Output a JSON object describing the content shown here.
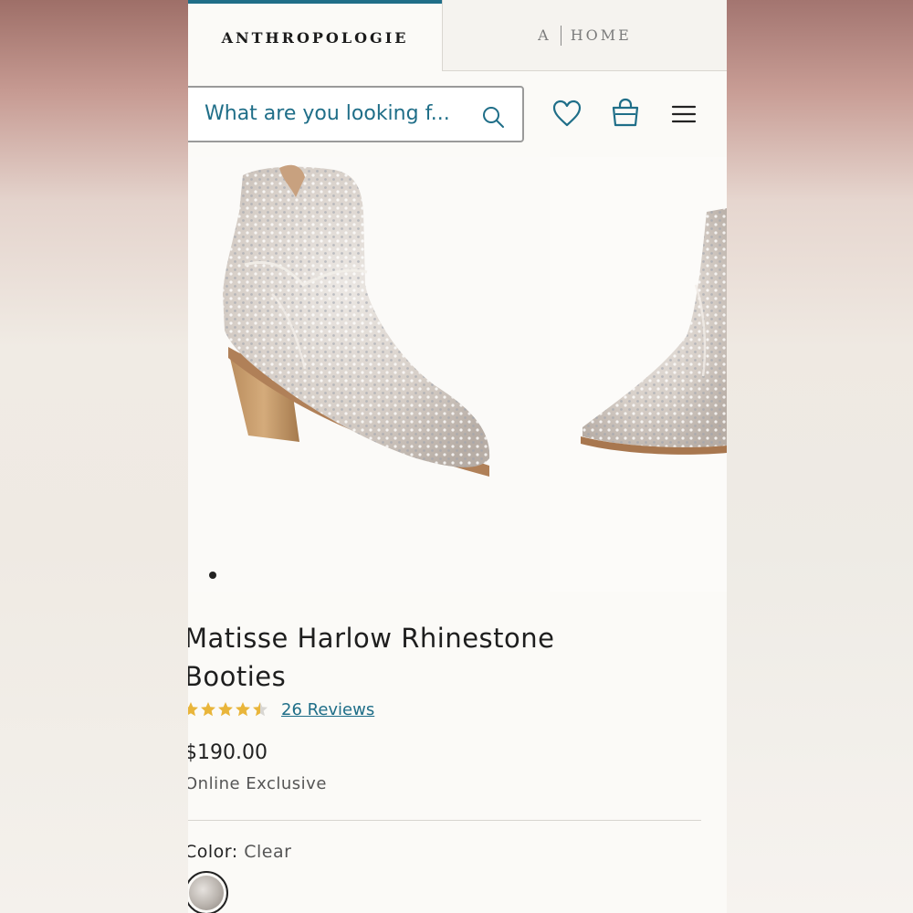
{
  "brands": {
    "primary_tab": "ANTHROPOLOGIE",
    "home_tab_a": "A",
    "home_tab_home": "HOME"
  },
  "search": {
    "placeholder": "What are you looking f..."
  },
  "icons": {
    "search": "search-icon",
    "wishlist": "heart-icon",
    "bag": "shopping-bag-icon",
    "menu": "hamburger-menu-icon"
  },
  "gallery": {
    "slide_count_visible": 2,
    "active_dot": 1
  },
  "product": {
    "title_line1": "Matisse Harlow Rhinestone",
    "title_line2": "Booties",
    "rating": 4.5,
    "rating_max": 5,
    "reviews_label": "26 Reviews",
    "price": "$190.00",
    "availability": "Online Exclusive",
    "color_label": "Color:",
    "color_value": "Clear"
  },
  "colors": {
    "accent": "#1f6e88",
    "star": "#e9b53a",
    "text": "#1e1e1e"
  }
}
